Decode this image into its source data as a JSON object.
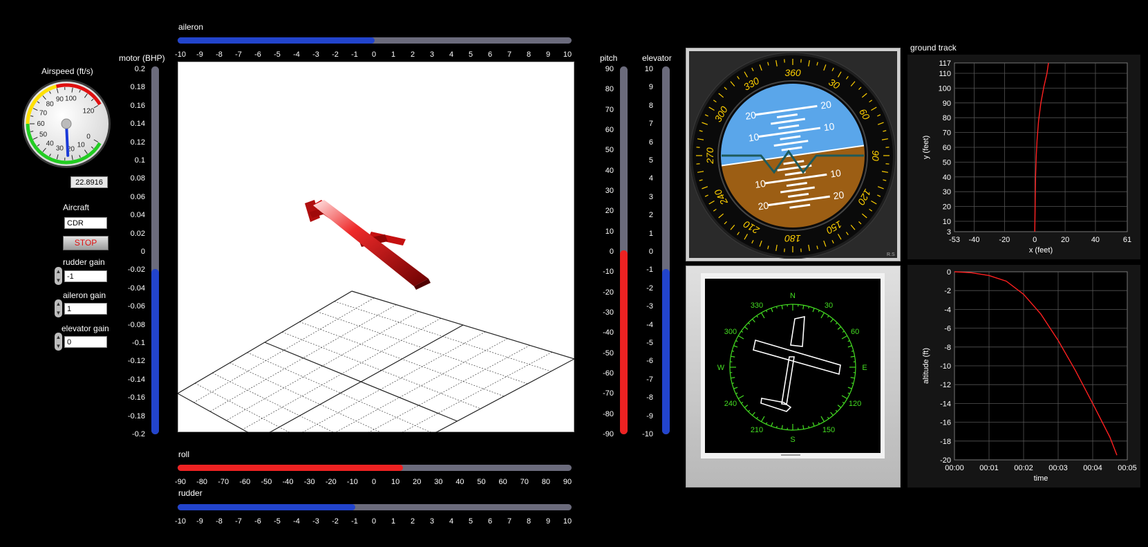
{
  "airspeed": {
    "label": "Airspeed (ft/s)",
    "value": "22.8916",
    "dial_ticks": [
      "0",
      "10",
      "20",
      "30",
      "40",
      "50",
      "60",
      "70",
      "80",
      "90",
      "100",
      "120"
    ],
    "current": 22.8916,
    "max": 120
  },
  "controls": {
    "aircraft_label": "Aircraft",
    "aircraft_value": "CDR",
    "stop_label": "STOP",
    "rudder_gain_label": "rudder gain",
    "rudder_gain_value": "-1",
    "aileron_gain_label": "aileron gain",
    "aileron_gain_value": "1",
    "elevator_gain_label": "elevator gain",
    "elevator_gain_value": "0"
  },
  "motor": {
    "label": "motor (BHP)",
    "ticks": [
      "0.2",
      "0.18",
      "0.16",
      "0.14",
      "0.12",
      "0.1",
      "0.08",
      "0.06",
      "0.04",
      "0.02",
      "0",
      "-0.02",
      "-0.04",
      "-0.06",
      "-0.08",
      "-0.1",
      "-0.12",
      "-0.14",
      "-0.16",
      "-0.18",
      "-0.2"
    ],
    "value": -0.02,
    "color": "#2244cc"
  },
  "aileron": {
    "label": "aileron",
    "ticks": [
      "-10",
      "-9",
      "-8",
      "-7",
      "-6",
      "-5",
      "-4",
      "-3",
      "-2",
      "-1",
      "0",
      "1",
      "2",
      "3",
      "4",
      "5",
      "6",
      "7",
      "8",
      "9",
      "10"
    ],
    "value": 0,
    "color": "#2244cc"
  },
  "roll": {
    "label": "roll",
    "ticks": [
      "-90",
      "-80",
      "-70",
      "-60",
      "-50",
      "-40",
      "-30",
      "-20",
      "-10",
      "0",
      "10",
      "20",
      "30",
      "40",
      "50",
      "60",
      "70",
      "80",
      "90"
    ],
    "value": 13,
    "color": "#ee2222"
  },
  "rudder": {
    "label": "rudder",
    "ticks": [
      "-10",
      "-9",
      "-8",
      "-7",
      "-6",
      "-5",
      "-4",
      "-3",
      "-2",
      "-1",
      "0",
      "1",
      "2",
      "3",
      "4",
      "5",
      "6",
      "7",
      "8",
      "9",
      "10"
    ],
    "value": -1,
    "color": "#2244cc"
  },
  "pitch": {
    "label": "pitch",
    "ticks": [
      "90",
      "80",
      "70",
      "60",
      "50",
      "40",
      "30",
      "20",
      "10",
      "0",
      "-10",
      "-20",
      "-30",
      "-40",
      "-50",
      "-60",
      "-70",
      "-80",
      "-90"
    ],
    "value": 0,
    "color": "#ee2222"
  },
  "elevator": {
    "label": "elevator",
    "ticks": [
      "10",
      "9",
      "8",
      "7",
      "6",
      "5",
      "4",
      "3",
      "2",
      "1",
      "0",
      "-1",
      "-2",
      "-3",
      "-4",
      "-5",
      "-6",
      "-7",
      "-8",
      "-9",
      "-10"
    ],
    "value": -1,
    "color": "#2244cc"
  },
  "attitude": {
    "heading_labels": [
      "360",
      "30",
      "60",
      "90",
      "120",
      "150",
      "180",
      "210",
      "240",
      "270",
      "300",
      "330"
    ],
    "pitch_labels": [
      "20",
      "10",
      "10",
      "20"
    ],
    "maker_mark": "R.S",
    "sky_color": "#5aa6ea",
    "ground_color": "#9c5e14"
  },
  "compass": {
    "labels": [
      "N",
      "30",
      "60",
      "E",
      "120",
      "150",
      "S",
      "210",
      "240",
      "W",
      "300",
      "330"
    ],
    "color": "#44dd22"
  },
  "ground_track": {
    "title": "ground track",
    "xlabel": "x (feet)",
    "ylabel": "y (feet)",
    "x_ticks": [
      "-53",
      "-40",
      "-20",
      "0",
      "20",
      "40",
      "61"
    ],
    "y_ticks": [
      "117",
      "110",
      "100",
      "90",
      "80",
      "70",
      "60",
      "50",
      "40",
      "30",
      "20",
      "10",
      "3"
    ]
  },
  "altitude": {
    "xlabel": "time",
    "ylabel": "altitude (ft)",
    "x_ticks": [
      "00:00",
      "00:01",
      "00:02",
      "00:03",
      "00:04",
      "00:05"
    ],
    "y_ticks": [
      "0",
      "-2",
      "-4",
      "-6",
      "-8",
      "-10",
      "-12",
      "-14",
      "-16",
      "-18",
      "-20"
    ]
  },
  "chart_data": [
    {
      "type": "line",
      "title": "ground track",
      "xlabel": "x (feet)",
      "ylabel": "y (feet)",
      "xlim": [
        -53,
        61
      ],
      "ylim": [
        3,
        117
      ],
      "grid": true,
      "series": [
        {
          "x": [
            0,
            0.2,
            0.5,
            1,
            1.5,
            2.5,
            4,
            6,
            8,
            9
          ],
          "y": [
            3,
            20,
            40,
            55,
            65,
            78,
            90,
            101,
            110,
            117
          ]
        }
      ]
    },
    {
      "type": "line",
      "xlabel": "time",
      "ylabel": "altitude (ft)",
      "xlim": [
        0,
        5
      ],
      "ylim": [
        -20,
        0
      ],
      "grid": true,
      "series": [
        {
          "x": [
            0,
            0.5,
            1,
            1.5,
            2,
            2.5,
            3,
            3.5,
            4,
            4.5,
            4.7
          ],
          "y": [
            0,
            -0.1,
            -0.4,
            -1.0,
            -2.4,
            -4.5,
            -7.3,
            -10.5,
            -14.0,
            -17.6,
            -19.5
          ]
        }
      ]
    }
  ]
}
